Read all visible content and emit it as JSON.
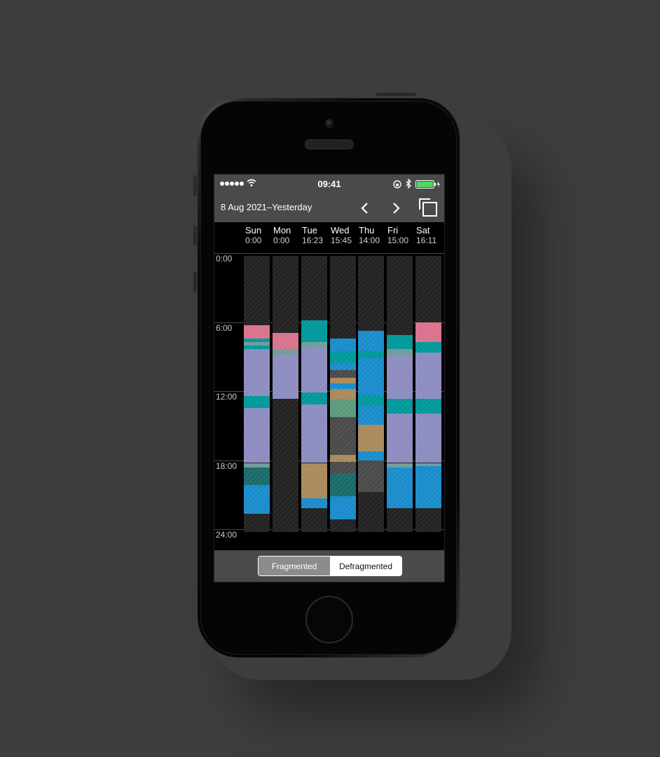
{
  "status": {
    "time": "09:41"
  },
  "nav": {
    "title": "8 Aug 2021–Yesterday"
  },
  "days": [
    {
      "name": "Sun",
      "time": "0:00"
    },
    {
      "name": "Mon",
      "time": "0:00"
    },
    {
      "name": "Tue",
      "time": "16:23"
    },
    {
      "name": "Wed",
      "time": "15:45"
    },
    {
      "name": "Thu",
      "time": "14:00"
    },
    {
      "name": "Fri",
      "time": "15:00"
    },
    {
      "name": "Sat",
      "time": "16:11"
    }
  ],
  "hours": [
    "0:00",
    "6:00",
    "12:00",
    "18:00",
    "24:00"
  ],
  "colors": {
    "pink": "#d9728c",
    "teal": "#00989a",
    "gray_teal": "#6f9c99",
    "lavender": "#8c8cc0",
    "blue": "#1a8ccc",
    "tan": "#a88a5c",
    "green_gray": "#5a9a7c",
    "dark_gray": "#4a4a4a",
    "dark_teal": "#1a6a6a"
  },
  "chart_data": {
    "type": "bar",
    "stacked": true,
    "categories": [
      "Sun",
      "Mon",
      "Tue",
      "Wed",
      "Thu",
      "Fri",
      "Sat"
    ],
    "y_unit": "hour of day",
    "ylim": [
      0,
      24
    ],
    "yticks": [
      "0:00",
      "6:00",
      "12:00",
      "18:00",
      "24:00"
    ],
    "columns": [
      {
        "day": "Sun",
        "segments": [
          {
            "start": 6.0,
            "end": 7.2,
            "color": "pink"
          },
          {
            "start": 7.2,
            "end": 7.5,
            "color": "teal"
          },
          {
            "start": 7.5,
            "end": 7.8,
            "color": "gray_teal"
          },
          {
            "start": 7.8,
            "end": 8.1,
            "color": "teal"
          },
          {
            "start": 8.1,
            "end": 12.2,
            "color": "lavender"
          },
          {
            "start": 12.2,
            "end": 13.2,
            "color": "teal"
          },
          {
            "start": 13.2,
            "end": 18.0,
            "color": "lavender"
          },
          {
            "start": 18.0,
            "end": 18.4,
            "color": "gray_teal"
          },
          {
            "start": 18.4,
            "end": 19.9,
            "color": "dark_teal"
          },
          {
            "start": 19.9,
            "end": 22.4,
            "color": "blue"
          }
        ]
      },
      {
        "day": "Mon",
        "segments": [
          {
            "start": 6.7,
            "end": 8.1,
            "color": "pink"
          },
          {
            "start": 8.1,
            "end": 8.6,
            "color": "gray_teal"
          },
          {
            "start": 8.6,
            "end": 12.4,
            "color": "lavender"
          }
        ]
      },
      {
        "day": "Tue",
        "segments": [
          {
            "start": 5.6,
            "end": 7.5,
            "color": "teal"
          },
          {
            "start": 7.5,
            "end": 7.9,
            "color": "gray_teal"
          },
          {
            "start": 7.9,
            "end": 11.9,
            "color": "lavender"
          },
          {
            "start": 11.9,
            "end": 12.9,
            "color": "teal"
          },
          {
            "start": 12.9,
            "end": 18.0,
            "color": "lavender"
          },
          {
            "start": 18.0,
            "end": 21.1,
            "color": "tan"
          },
          {
            "start": 21.1,
            "end": 21.9,
            "color": "blue"
          }
        ]
      },
      {
        "day": "Wed",
        "segments": [
          {
            "start": 7.2,
            "end": 8.3,
            "color": "blue"
          },
          {
            "start": 8.3,
            "end": 9.3,
            "color": "teal"
          },
          {
            "start": 9.3,
            "end": 9.9,
            "color": "blue"
          },
          {
            "start": 9.9,
            "end": 10.6,
            "color": "dark_gray"
          },
          {
            "start": 10.6,
            "end": 11.1,
            "color": "tan"
          },
          {
            "start": 11.1,
            "end": 11.6,
            "color": "blue"
          },
          {
            "start": 11.6,
            "end": 12.5,
            "color": "tan"
          },
          {
            "start": 12.5,
            "end": 14.0,
            "color": "green_gray"
          },
          {
            "start": 14.0,
            "end": 17.3,
            "color": "dark_gray"
          },
          {
            "start": 17.3,
            "end": 17.9,
            "color": "tan"
          },
          {
            "start": 17.9,
            "end": 18.9,
            "color": "dark_gray"
          },
          {
            "start": 18.9,
            "end": 20.9,
            "color": "dark_teal"
          },
          {
            "start": 20.9,
            "end": 22.9,
            "color": "blue"
          }
        ]
      },
      {
        "day": "Thu",
        "segments": [
          {
            "start": 6.5,
            "end": 8.3,
            "color": "blue"
          },
          {
            "start": 8.3,
            "end": 8.9,
            "color": "teal"
          },
          {
            "start": 8.9,
            "end": 12.1,
            "color": "blue"
          },
          {
            "start": 12.1,
            "end": 13.0,
            "color": "teal"
          },
          {
            "start": 13.0,
            "end": 14.7,
            "color": "blue"
          },
          {
            "start": 14.7,
            "end": 17.0,
            "color": "tan"
          },
          {
            "start": 17.0,
            "end": 17.8,
            "color": "blue"
          },
          {
            "start": 17.8,
            "end": 20.5,
            "color": "dark_gray"
          }
        ]
      },
      {
        "day": "Fri",
        "segments": [
          {
            "start": 6.9,
            "end": 8.1,
            "color": "teal"
          },
          {
            "start": 8.1,
            "end": 8.6,
            "color": "gray_teal"
          },
          {
            "start": 8.6,
            "end": 12.4,
            "color": "lavender"
          },
          {
            "start": 12.4,
            "end": 13.7,
            "color": "teal"
          },
          {
            "start": 13.7,
            "end": 18.0,
            "color": "lavender"
          },
          {
            "start": 18.0,
            "end": 18.4,
            "color": "gray_teal"
          },
          {
            "start": 18.4,
            "end": 19.9,
            "color": "blue"
          },
          {
            "start": 19.9,
            "end": 21.9,
            "color": "blue"
          }
        ]
      },
      {
        "day": "Sat",
        "segments": [
          {
            "start": 5.8,
            "end": 7.5,
            "color": "pink"
          },
          {
            "start": 7.5,
            "end": 8.4,
            "color": "teal"
          },
          {
            "start": 8.4,
            "end": 12.4,
            "color": "lavender"
          },
          {
            "start": 12.4,
            "end": 13.7,
            "color": "teal"
          },
          {
            "start": 13.7,
            "end": 18.0,
            "color": "lavender"
          },
          {
            "start": 18.0,
            "end": 18.3,
            "color": "gray_teal"
          },
          {
            "start": 18.3,
            "end": 19.9,
            "color": "blue"
          },
          {
            "start": 19.9,
            "end": 21.9,
            "color": "blue"
          }
        ]
      }
    ]
  },
  "segmented": {
    "fragmented": "Fragmented",
    "defragmented": "Defragmented",
    "selected": "Defragmented"
  }
}
